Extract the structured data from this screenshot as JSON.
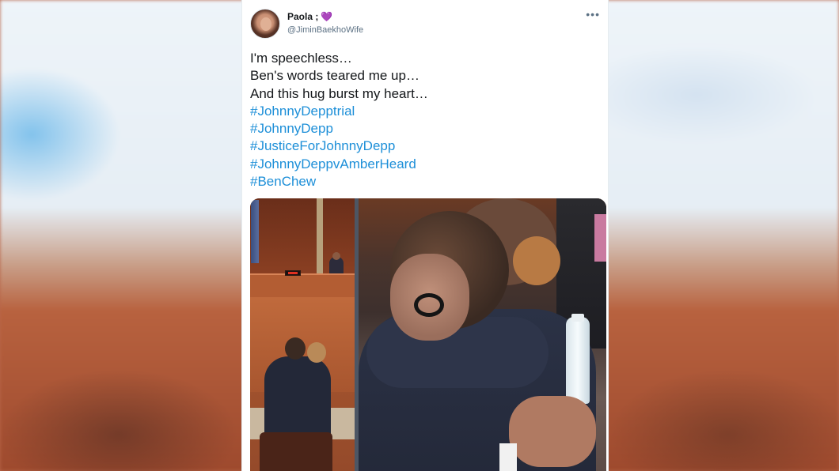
{
  "tweet": {
    "display_name": "Paola ;",
    "name_emoji": "💜",
    "handle": "@JiminBaekhoWife",
    "more_icon": "more-horizontal-icon",
    "text_lines": [
      "I'm speechless…",
      "Ben's words teared me up…",
      "And this hug burst my heart…"
    ],
    "hashtags": [
      "#JohnnyDepptrial",
      "#JohnnyDepp",
      "#JusticeForJohnnyDepp",
      "#JohnnyDeppvAmberHeard",
      "#BenChew"
    ],
    "hashtag_color": "#1d8fd8"
  }
}
